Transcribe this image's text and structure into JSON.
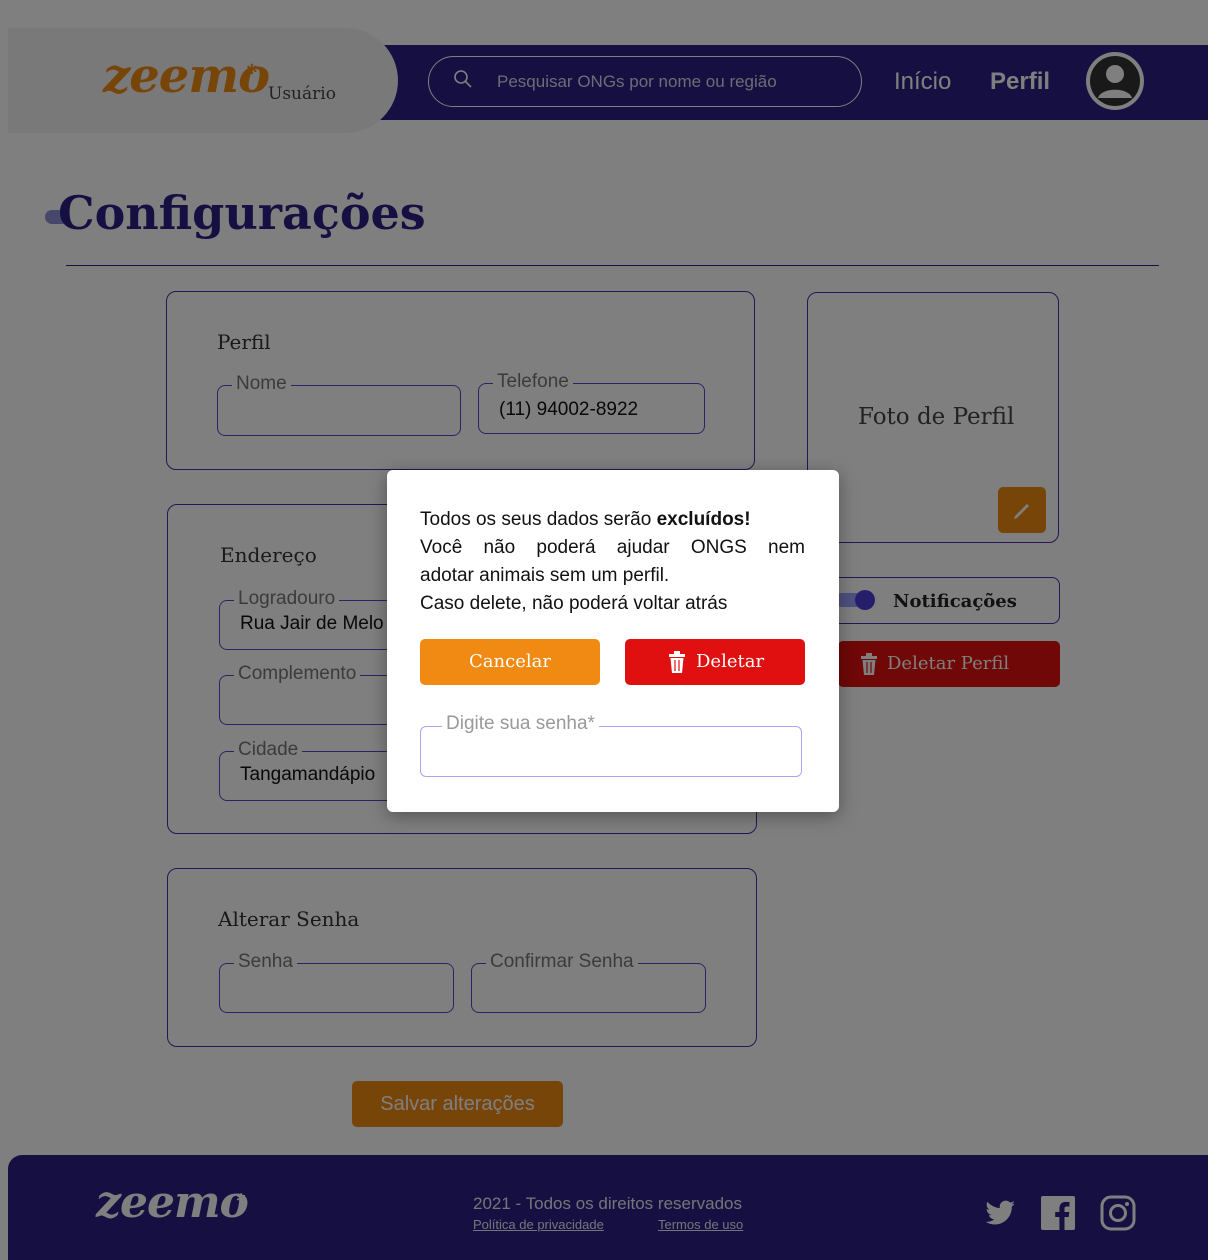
{
  "header": {
    "logo": "zeemo",
    "brand_subtitle": "Usuário",
    "search_placeholder": "Pesquisar ONGs por nome ou região",
    "nav_inicio": "Início",
    "nav_perfil": "Perfil"
  },
  "page": {
    "title": "Configurações"
  },
  "profile": {
    "title": "Perfil",
    "name_label": "Nome",
    "name_value": "",
    "phone_label": "Telefone",
    "phone_value": "(11) 94002-8922"
  },
  "address": {
    "title": "Endereço",
    "street_label": "Logradouro",
    "street_value": "Rua Jair de Melo",
    "complement_label": "Complemento",
    "complement_value": "",
    "city_label": "Cidade",
    "city_value": "Tangamandápio"
  },
  "password_change": {
    "title": "Alterar Senha",
    "password_label": "Senha",
    "confirm_label": "Confirmar Senha"
  },
  "sidebar": {
    "photo_label": "Foto de Perfil",
    "notifications_label": "Notificações",
    "notifications_on": true,
    "delete_profile_label": "Deletar Perfil"
  },
  "save_button": "Salvar alterações",
  "footer": {
    "logo": "zeemo",
    "copyright": "2021 - Todos os direitos reservados",
    "privacy": "Política de privacidade",
    "terms": "Termos de uso"
  },
  "modal": {
    "line1_prefix": "Todos os seus dados serão ",
    "line1_bold": "excluídos!",
    "line2": "Você não poderá ajudar ONGS nem",
    "line3": "adotar animais sem um perfil.",
    "line4": "Caso delete, não poderá voltar atrás",
    "cancel_label": "Cancelar",
    "delete_label": "Deletar",
    "password_placeholder": "Digite sua senha*"
  },
  "colors": {
    "primary": "#2d1f82",
    "accent": "#f08a12",
    "danger": "#e01010"
  },
  "icons": [
    "search-icon",
    "avatar-icon",
    "pencil-icon",
    "trash-icon",
    "twitter-icon",
    "facebook-icon",
    "instagram-icon",
    "paw-icon"
  ]
}
